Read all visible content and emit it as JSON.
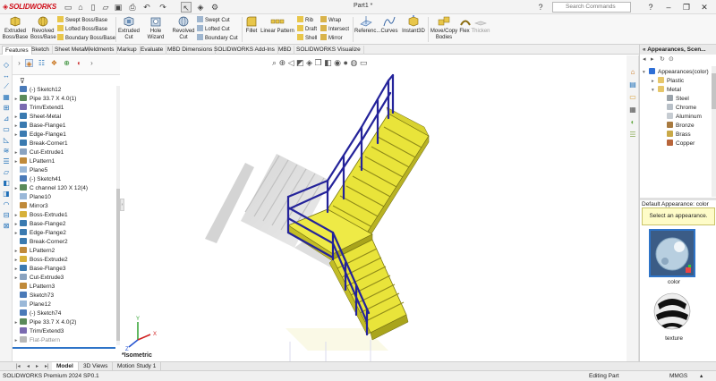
{
  "app": {
    "logo_text": "SOLIDWORKS",
    "doc_title": "Part1 *",
    "search_placeholder": "Search Commands"
  },
  "commands": {
    "extruded_boss": "Extruded Boss/Base",
    "revolved_boss": "Revolved Boss/Base",
    "swept_boss": "Swept Boss/Base",
    "lofted_boss": "Lofted Boss/Base",
    "boundary_boss": "Boundary Boss/Base",
    "extruded_cut": "Extruded Cut",
    "hole_wizard": "Hole Wizard",
    "revolved_cut": "Revolved Cut",
    "swept_cut": "Swept Cut",
    "lofted_cut": "Lofted Cut",
    "boundary_cut": "Boundary Cut",
    "fillet": "Fillet",
    "linear_pattern": "Linear Pattern",
    "rib": "Rib",
    "draft": "Draft",
    "shell": "Shell",
    "wrap": "Wrap",
    "intersect": "Intersect",
    "mirror": "Mirror",
    "reference": "Referenc...",
    "curves": "Curves",
    "instant3d": "Instant3D",
    "move_copy": "Move/Copy Bodies",
    "flex": "Flex",
    "thicken": "Thicken"
  },
  "cm_tabs": [
    "Features",
    "Sketch",
    "Sheet Metal",
    "Weldments",
    "Markup",
    "Evaluate",
    "MBD Dimensions",
    "SOLIDWORKS Add-Ins",
    "MBD",
    "SOLIDWORKS Visualize"
  ],
  "tree_items": [
    {
      "label": "(-) Sketch12",
      "expand": false,
      "type": "sketch",
      "grey": false
    },
    {
      "label": "Pipe 33.7 X 4.0(1)",
      "expand": true,
      "type": "weld",
      "grey": false
    },
    {
      "label": "Trim/Extend1",
      "expand": false,
      "type": "trim",
      "grey": false
    },
    {
      "label": "Sheet-Metal",
      "expand": true,
      "type": "sheet",
      "grey": false
    },
    {
      "label": "Base-Flange1",
      "expand": true,
      "type": "flange",
      "grey": false
    },
    {
      "label": "Edge-Flange1",
      "expand": true,
      "type": "flange",
      "grey": false
    },
    {
      "label": "Break-Corner1",
      "expand": false,
      "type": "corner",
      "grey": false
    },
    {
      "label": "Cut-Extrude1",
      "expand": true,
      "type": "cut",
      "grey": false
    },
    {
      "label": "LPattern1",
      "expand": true,
      "type": "pattern",
      "grey": false
    },
    {
      "label": "Plane5",
      "expand": false,
      "type": "plane",
      "grey": false
    },
    {
      "label": "(-) Sketch41",
      "expand": false,
      "type": "sketch",
      "grey": false
    },
    {
      "label": "C channel 120 X 12(4)",
      "expand": true,
      "type": "weld",
      "grey": false
    },
    {
      "label": "Plane10",
      "expand": false,
      "type": "plane",
      "grey": false
    },
    {
      "label": "Mirror3",
      "expand": false,
      "type": "mirror",
      "grey": false
    },
    {
      "label": "Boss-Extrude1",
      "expand": true,
      "type": "boss",
      "grey": false
    },
    {
      "label": "Base-Flange2",
      "expand": true,
      "type": "flange",
      "grey": false
    },
    {
      "label": "Edge-Flange2",
      "expand": true,
      "type": "flange",
      "grey": false
    },
    {
      "label": "Break-Corner2",
      "expand": false,
      "type": "corner",
      "grey": false
    },
    {
      "label": "LPattern2",
      "expand": true,
      "type": "pattern",
      "grey": false
    },
    {
      "label": "Boss-Extrude2",
      "expand": true,
      "type": "boss",
      "grey": false
    },
    {
      "label": "Base-Flange3",
      "expand": true,
      "type": "flange",
      "grey": false
    },
    {
      "label": "Cut-Extrude3",
      "expand": true,
      "type": "cut",
      "grey": false
    },
    {
      "label": "LPattern3",
      "expand": false,
      "type": "pattern",
      "grey": false
    },
    {
      "label": "Sketch73",
      "expand": false,
      "type": "sketch",
      "grey": false
    },
    {
      "label": "Plane12",
      "expand": false,
      "type": "plane",
      "grey": false
    },
    {
      "label": "(-) Sketch74",
      "expand": false,
      "type": "sketch",
      "grey": false
    },
    {
      "label": "Pipe 33.7 X 4.0(2)",
      "expand": true,
      "type": "weld",
      "grey": false
    },
    {
      "label": "Trim/Extend3",
      "expand": false,
      "type": "trim",
      "grey": false
    },
    {
      "label": "Flat-Pattern",
      "expand": true,
      "type": "flat",
      "grey": true
    }
  ],
  "graphics": {
    "view_label": "*Isometric",
    "axis_x": "X",
    "axis_y": "Y",
    "axis_z": "Z"
  },
  "right_pane": {
    "title": "Appearances, Scen...",
    "items": [
      {
        "label": "Appearances(color)",
        "level": 0,
        "expand": "open",
        "color": "#2f6fd6"
      },
      {
        "label": "Plastic",
        "level": 1,
        "expand": "closed",
        "color": "#e6c66a"
      },
      {
        "label": "Metal",
        "level": 1,
        "expand": "open",
        "color": "#e6c66a"
      },
      {
        "label": "Steel",
        "level": 2,
        "expand": "none",
        "color": "#9aa3ab"
      },
      {
        "label": "Chrome",
        "level": 2,
        "expand": "none",
        "color": "#b8c0c8"
      },
      {
        "label": "Aluminum",
        "level": 2,
        "expand": "none",
        "color": "#c6ccd2"
      },
      {
        "label": "Bronze",
        "level": 2,
        "expand": "none",
        "color": "#a87a40"
      },
      {
        "label": "Brass",
        "level": 2,
        "expand": "none",
        "color": "#c9a948"
      },
      {
        "label": "Copper",
        "level": 2,
        "expand": "none",
        "color": "#b8653a"
      }
    ],
    "default_label": "Default Appearance: color",
    "hint": "Select an appearance.",
    "thumbs": [
      {
        "label": "color"
      },
      {
        "label": "texture"
      }
    ]
  },
  "bottom_tabs": [
    "Model",
    "3D Views",
    "Motion Study 1"
  ],
  "status": {
    "app_version": "SOLIDWORKS Premium 2024 SP0.1",
    "mode": "Editing Part",
    "units": "MMGS"
  },
  "colors": {
    "stair": "#e9e43a",
    "stair_dark": "#a9a41c",
    "railing": "#24239a",
    "accent": "#2e74c8",
    "brand": "#d0101b"
  }
}
